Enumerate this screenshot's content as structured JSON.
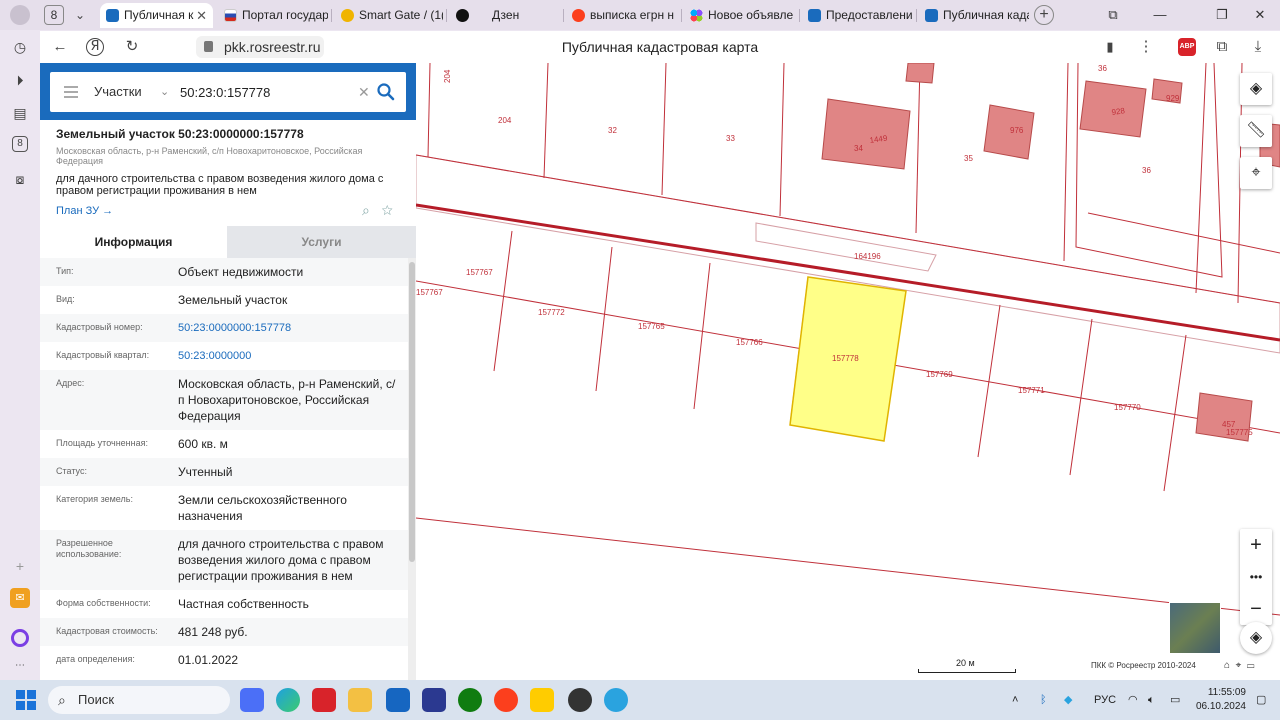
{
  "browser": {
    "tab_counter": "8",
    "tabs": [
      {
        "label": "Публичная к",
        "active": true,
        "color": "#1a6bbd"
      },
      {
        "label": "Портал государ",
        "active": false,
        "color": "#d52b1e"
      },
      {
        "label": "Smart Gate / (1(",
        "active": false,
        "color": "#f0b400"
      },
      {
        "label": "Дзен",
        "active": false,
        "color": "#111111"
      },
      {
        "label": "выписка егрн н",
        "active": false,
        "color": "#fc3f1d"
      },
      {
        "label": "Новое объявле",
        "active": false,
        "color": "#8a4fff"
      },
      {
        "label": "Предоставлени",
        "active": false,
        "color": "#1a6bbd"
      },
      {
        "label": "Публичная када",
        "active": false,
        "color": "#1a6bbd"
      }
    ],
    "url": "pkk.rosreestr.ru",
    "page_title": "Публичная кадастровая карта",
    "abp_label": "ABP"
  },
  "search": {
    "type_label": "Участки",
    "query": "50:23:0:157778"
  },
  "card": {
    "title": "Земельный участок 50:23:0000000:157778",
    "address_small": "Московская область, р-н Раменский, с/п Новохаритоновское, Российская Федерация",
    "description": "для дачного строительства с правом возведения жилого дома с правом регистрации проживания в нем",
    "plan_link": "План ЗУ →",
    "tab_info": "Информация",
    "tab_services": "Услуги",
    "rows": [
      {
        "label": "Тип:",
        "value": "Объект недвижимости",
        "link": false
      },
      {
        "label": "Вид:",
        "value": "Земельный участок",
        "link": false
      },
      {
        "label": "Кадастровый номер:",
        "value": "50:23:0000000:157778",
        "link": true
      },
      {
        "label": "Кадастровый квартал:",
        "value": "50:23:0000000",
        "link": true
      },
      {
        "label": "Адрес:",
        "value": "Московская область, р-н Раменский, с/п Новохаритоновское, Российская Федерация",
        "link": false
      },
      {
        "label": "Площадь уточненная:",
        "value": "600 кв. м",
        "link": false
      },
      {
        "label": "Статус:",
        "value": "Учтенный",
        "link": false
      },
      {
        "label": "Категория земель:",
        "value": "Земли сельскохозяйственного назначения",
        "link": false
      },
      {
        "label": "Разрешенное использование:",
        "value": "для дачного строительства с правом возведения жилого дома с правом регистрации проживания в нем",
        "link": false
      },
      {
        "label": "Форма собственности:",
        "value": "Частная собственность",
        "link": false
      },
      {
        "label": "Кадастровая стоимость:",
        "value": "481 248 руб.",
        "link": false
      },
      {
        "label": "дата определения:",
        "value": "01.01.2022",
        "link": false
      }
    ]
  },
  "map": {
    "parcel_labels": [
      "204",
      "204",
      "32",
      "33",
      "34",
      "1449",
      "976",
      "35",
      "928",
      "929",
      "36",
      "36",
      "164196",
      "157767",
      "157767",
      "157772",
      "157765",
      "157766",
      "157778",
      "157769",
      "157771",
      "157770",
      "457",
      "157775"
    ],
    "scale_label": "20 м",
    "copyright": "ПКК © Росреестр 2010-2024",
    "highlight_color": "#ffff88",
    "boundary_color": "#c0303a",
    "building_color": "#e08585"
  },
  "taskbar": {
    "search_label": "Поиск",
    "language": "РУС",
    "time": "11:55:09",
    "date": "06.10.2024"
  }
}
